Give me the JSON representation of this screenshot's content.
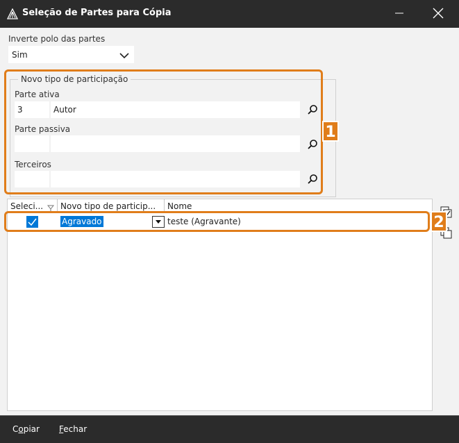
{
  "window": {
    "title": "Seleção de Partes para Cópia"
  },
  "invert": {
    "label": "Inverte polo das partes",
    "value": "Sim"
  },
  "group": {
    "legend": "Novo tipo de participação",
    "ativa": {
      "label": "Parte ativa",
      "code": "3",
      "name": "Autor"
    },
    "passiva": {
      "label": "Parte passiva",
      "code": "",
      "name": ""
    },
    "terceiros": {
      "label": "Terceiros",
      "code": "",
      "name": ""
    }
  },
  "grid": {
    "columns": [
      "Seleci...",
      "Novo tipo de particip...",
      "Nome"
    ],
    "rows": [
      {
        "selected": true,
        "tipo": "Agravado",
        "nome": "teste (Agravante)"
      }
    ]
  },
  "callouts": [
    "1",
    "2"
  ],
  "footer": {
    "copy_first": "C",
    "copy_ul": "o",
    "copy_rest": "piar",
    "close_ul": "F",
    "close_rest": "echar"
  },
  "colors": {
    "accent": "#e07d1a",
    "selection": "#0078d7",
    "chrome": "#2b2b2b"
  },
  "icons": [
    "app-logo-icon",
    "minimize-icon",
    "close-icon",
    "chevron-down-icon",
    "search-icon",
    "filter-icon",
    "check-icon",
    "select-all-icon",
    "deselect-all-icon"
  ]
}
